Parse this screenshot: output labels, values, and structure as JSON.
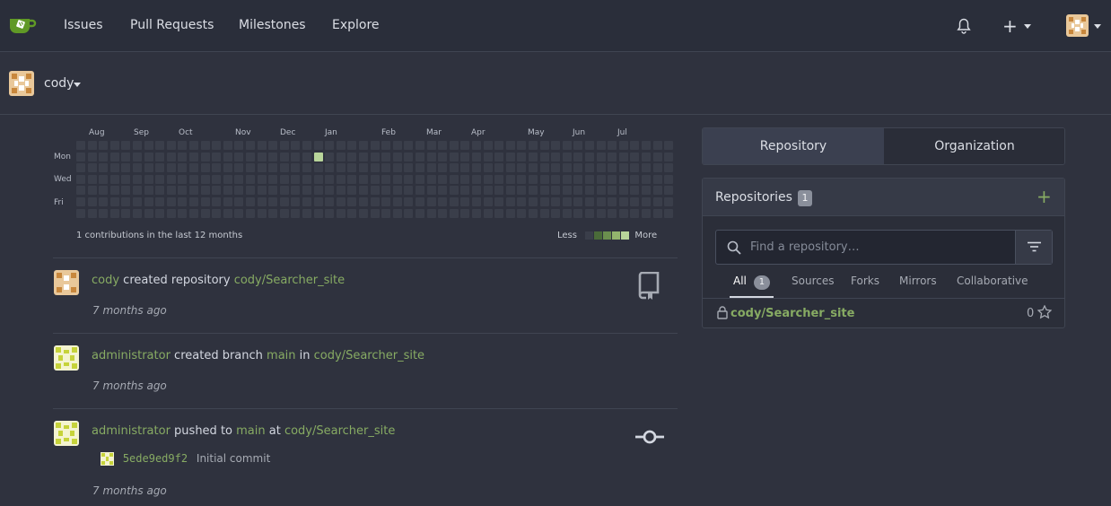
{
  "nav": {
    "items": [
      "Issues",
      "Pull Requests",
      "Milestones",
      "Explore"
    ],
    "plus": "+"
  },
  "user": {
    "name": "cody"
  },
  "heatmap": {
    "months": [
      "Aug",
      "Sep",
      "Oct",
      "Nov",
      "Dec",
      "Jan",
      "Feb",
      "Mar",
      "Apr",
      "May",
      "Jun",
      "Jul"
    ],
    "days": [
      "Mon",
      "Wed",
      "Fri"
    ],
    "summary": "1 contributions in the last 12 months",
    "less": "Less",
    "more": "More"
  },
  "feed": [
    {
      "actor": "cody",
      "action": " created repository ",
      "target": "cody/Searcher_site",
      "time": "7 months ago"
    },
    {
      "actor": "administrator",
      "action": " created branch ",
      "branch": "main",
      "connector": " in ",
      "target": "cody/Searcher_site",
      "time": "7 months ago"
    },
    {
      "actor": "administrator",
      "action": " pushed to ",
      "branch": "main",
      "connector": " at ",
      "target": "cody/Searcher_site",
      "time": "7 months ago",
      "commit_sha": "5ede9ed9f2",
      "commit_msg": "Initial commit"
    }
  ],
  "switcher": {
    "repository": "Repository",
    "organization": "Organization"
  },
  "repos": {
    "title": "Repositories",
    "count": "1",
    "add": "+",
    "search_placeholder": "Find a repository…",
    "tabs": [
      {
        "label": "All",
        "count": "1"
      },
      {
        "label": "Sources"
      },
      {
        "label": "Forks"
      },
      {
        "label": "Mirrors"
      },
      {
        "label": "Collaborative"
      }
    ],
    "items": [
      {
        "name": "cody/Searcher_site",
        "stars": "0"
      }
    ]
  },
  "colors": {
    "accent": "#87ab63",
    "heat_levels": [
      "#3a3e4a",
      "#4a6b39",
      "#6b8f4e",
      "#93b56d",
      "#b8d59a"
    ]
  }
}
